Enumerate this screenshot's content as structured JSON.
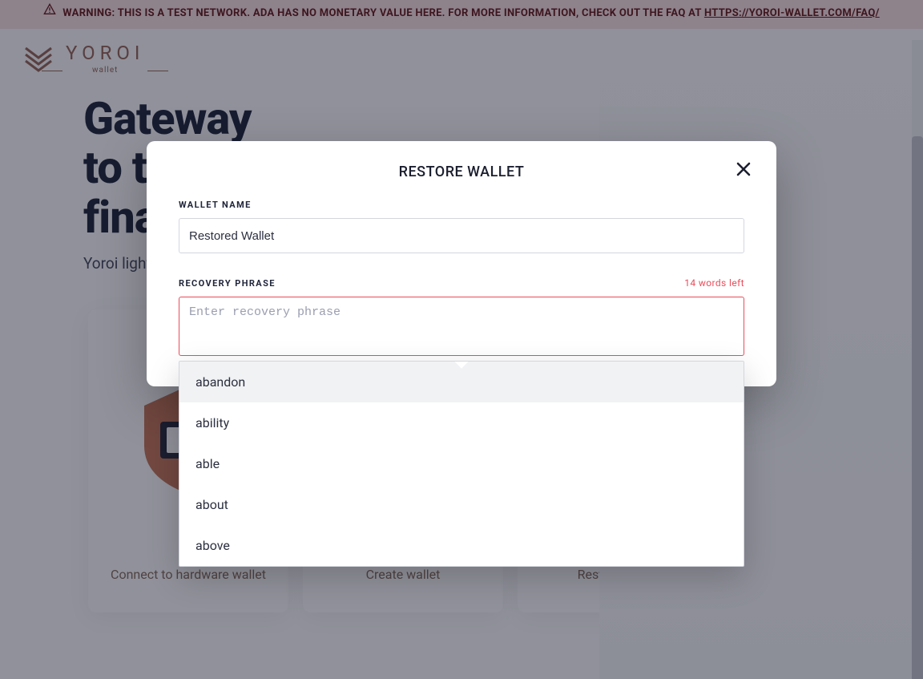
{
  "warning": {
    "prefix": "WARNING: THIS IS A TEST NETWORK. ADA HAS NO MONETARY VALUE HERE. FOR MORE INFORMATION, CHECK OUT THE FAQ AT ",
    "link_text": "HTTPS://YOROI-WALLET.COM/FAQ/"
  },
  "brand": {
    "name": "YOROI",
    "sub": "wallet"
  },
  "hero": {
    "line1": "Gateway",
    "line2": "to the",
    "line3": "financial world",
    "tagline": "Yoroi light wallet for Cardano assets"
  },
  "cards": [
    {
      "label": "Connect to hardware wallet"
    },
    {
      "label": "Create wallet"
    },
    {
      "label": "Restore wallet"
    }
  ],
  "modal": {
    "title": "RESTORE WALLET",
    "wallet_name_label": "WALLET NAME",
    "wallet_name_value": "Restored Wallet",
    "recovery_label": "RECOVERY PHRASE",
    "words_left": "14 words left",
    "recovery_placeholder": "Enter recovery phrase",
    "suggestions": [
      "abandon",
      "ability",
      "able",
      "about",
      "above"
    ]
  },
  "colors": {
    "accent_error": "#ea4c5a",
    "brand_brown": "#9b6b5e"
  }
}
